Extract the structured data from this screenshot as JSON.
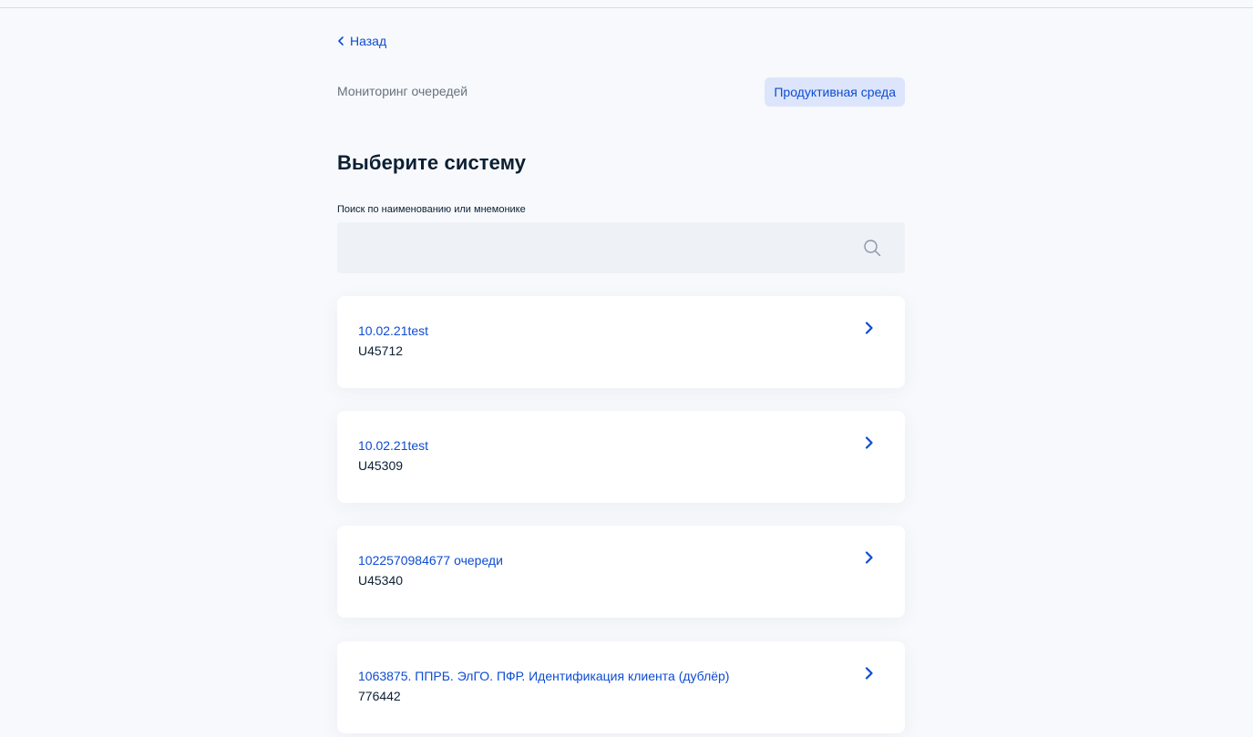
{
  "nav": {
    "back_label": "Назад"
  },
  "header": {
    "subtitle": "Мониторинг очередей",
    "environment_badge": "Продуктивная среда"
  },
  "main": {
    "title": "Выберите систему",
    "search": {
      "label": "Поиск по наименованию или мнемонике",
      "value": "",
      "placeholder": ""
    },
    "systems": [
      {
        "name": "10.02.21test",
        "code": "U45712"
      },
      {
        "name": "10.02.21test",
        "code": "U45309"
      },
      {
        "name": "1022570984677 очереди",
        "code": "U45340"
      },
      {
        "name": "1063875. ППРБ. ЭлГО. ПФР. Идентификация клиента (дублёр)",
        "code": "776442"
      }
    ]
  },
  "icons": {
    "back": "chevron-left-icon",
    "search": "search-icon",
    "item": "chevron-right-icon"
  },
  "colors": {
    "accent": "#0d4cd3",
    "background": "#f8f9fc",
    "badge_bg": "#dce5fb",
    "search_bg": "#eef1f6",
    "card_bg": "#ffffff"
  }
}
